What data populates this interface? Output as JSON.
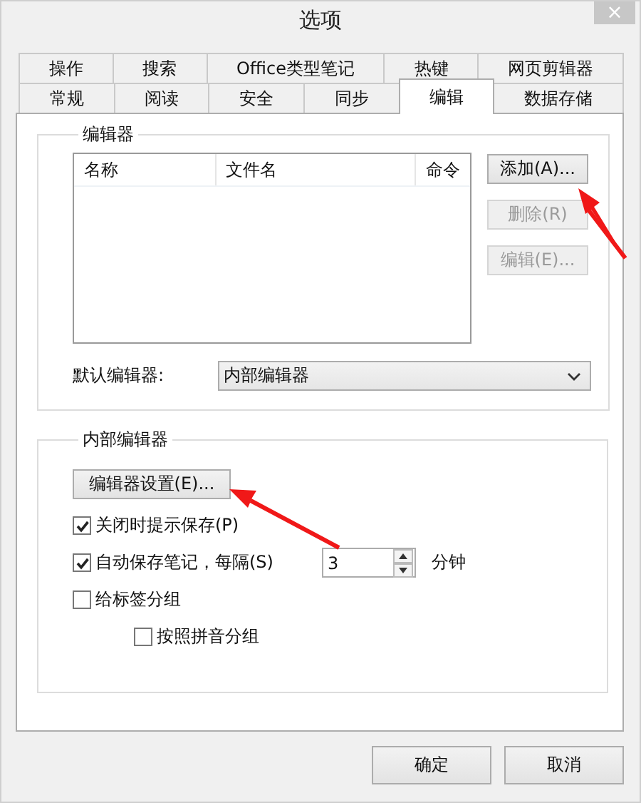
{
  "window": {
    "title": "选项",
    "close": "×"
  },
  "tab_rows": [
    [
      {
        "label": "操作",
        "selected": false
      },
      {
        "label": "搜索",
        "selected": false
      },
      {
        "label": "Office类型笔记",
        "selected": false
      },
      {
        "label": "热键",
        "selected": false
      },
      {
        "label": "网页剪辑器",
        "selected": false
      }
    ],
    [
      {
        "label": "常规",
        "selected": false
      },
      {
        "label": "阅读",
        "selected": false
      },
      {
        "label": "安全",
        "selected": false
      },
      {
        "label": "同步",
        "selected": false
      },
      {
        "label": "编辑",
        "selected": true
      },
      {
        "label": "数据存储",
        "selected": false
      }
    ]
  ],
  "editor_group": {
    "title": "编辑器",
    "table": {
      "columns": [
        "名称",
        "文件名",
        "命令"
      ]
    },
    "buttons": [
      {
        "label": "添加(A)...",
        "disabled": false
      },
      {
        "label": "删除(R)",
        "disabled": true
      },
      {
        "label": "编辑(E)...",
        "disabled": true
      }
    ],
    "default_editor": {
      "label": "默认编辑器:",
      "value": "内部编辑器"
    }
  },
  "internal_group": {
    "title": "内部编辑器",
    "settings_button": "编辑器设置(E)...",
    "options": [
      {
        "label": "关闭时提示保存(P)",
        "checked": true
      },
      {
        "label": "自动保存笔记，每隔(S)",
        "checked": true,
        "spinner": {
          "value": "3",
          "unit": "分钟"
        }
      },
      {
        "label": "给标签分组",
        "checked": false,
        "children": [
          {
            "label": "按照拼音分组",
            "checked": false
          }
        ]
      }
    ]
  },
  "buttons": [
    "确定",
    "取消"
  ]
}
